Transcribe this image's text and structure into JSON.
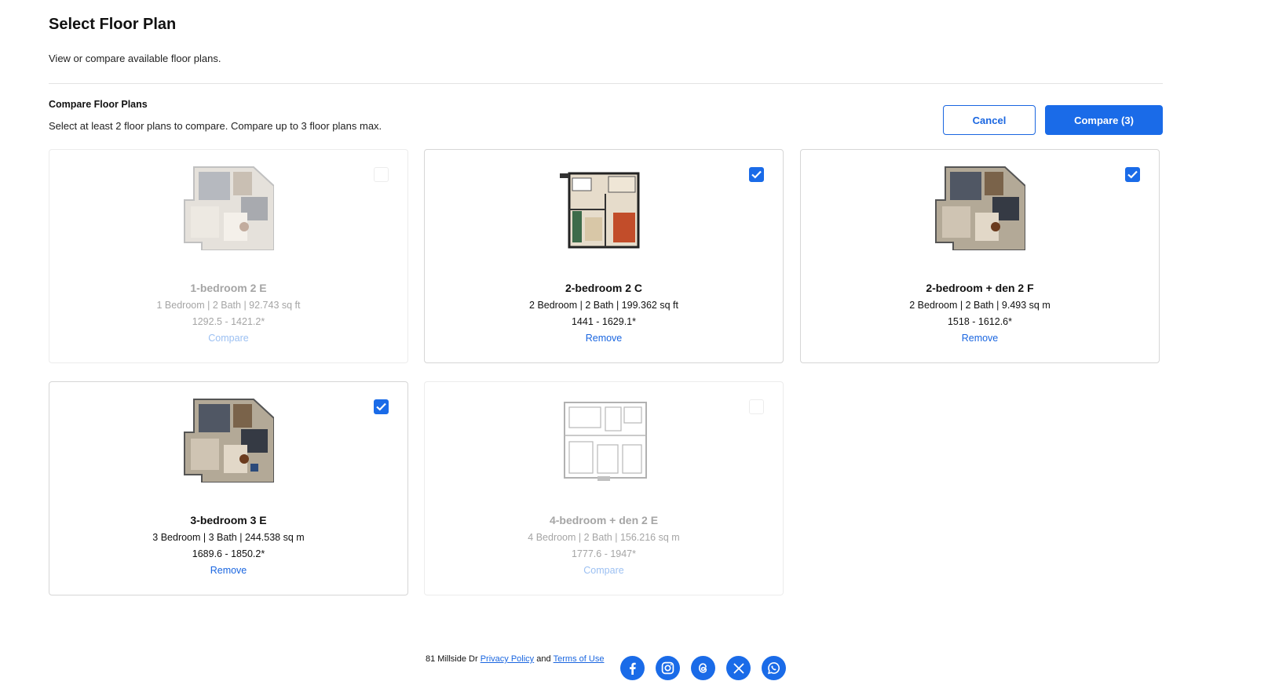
{
  "header": {
    "title": "Select Floor Plan",
    "subtitle": "View or compare available floor plans."
  },
  "compare": {
    "title": "Compare Floor Plans",
    "subtitle": "Select at least 2 floor plans to compare. Compare up to 3 floor plans max.",
    "cancel_label": "Cancel",
    "compare_label": "Compare (3)"
  },
  "plans": [
    {
      "name": "1-bedroom 2 E",
      "specs": "1 Bedroom | 2 Bath | 92.743 sq ft",
      "price": "1292.5 - 1421.2*",
      "action": "Compare",
      "checked": false
    },
    {
      "name": "2-bedroom 2 C",
      "specs": "2 Bedroom | 2 Bath | 199.362 sq ft",
      "price": "1441 - 1629.1*",
      "action": "Remove",
      "checked": true
    },
    {
      "name": "2-bedroom + den 2 F",
      "specs": "2 Bedroom | 2 Bath | 9.493 sq m",
      "price": "1518 - 1612.6*",
      "action": "Remove",
      "checked": true
    },
    {
      "name": "3-bedroom 3 E",
      "specs": "3 Bedroom | 3 Bath | 244.538 sq m",
      "price": "1689.6 - 1850.2*",
      "action": "Remove",
      "checked": true
    },
    {
      "name": "4-bedroom + den 2 E",
      "specs": "4 Bedroom | 2 Bath | 156.216 sq m",
      "price": "1777.6 - 1947*",
      "action": "Compare",
      "checked": false
    }
  ],
  "footer": {
    "address": "81 Millside Dr",
    "privacy_label": "Privacy Policy",
    "and_text": "and",
    "terms_label": "Terms of Use",
    "socials": [
      "facebook-icon",
      "instagram-icon",
      "threads-icon",
      "x-icon",
      "whatsapp-icon"
    ]
  },
  "colors": {
    "accent": "#1a6be8",
    "link": "#1a66e0"
  }
}
